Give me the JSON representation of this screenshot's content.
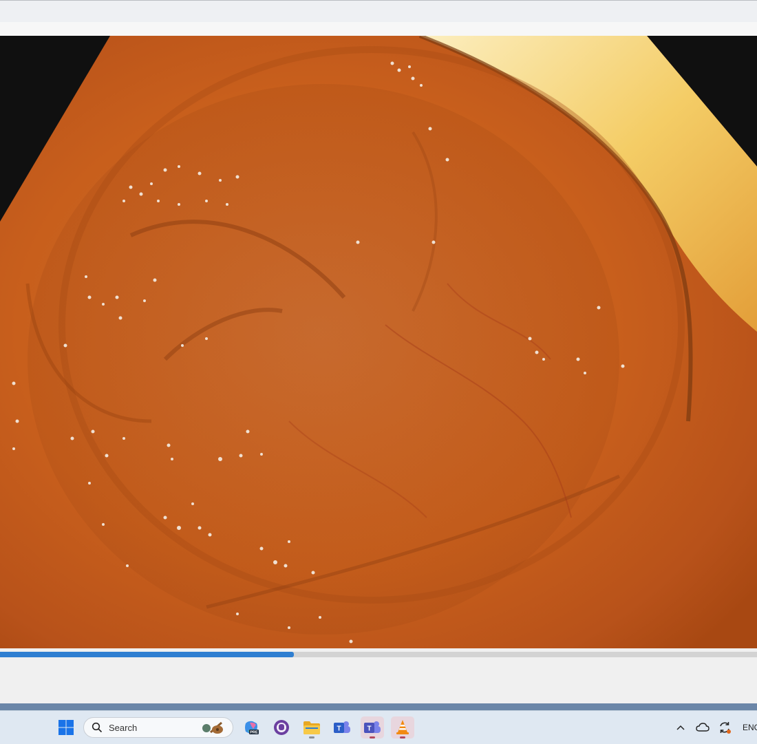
{
  "taskbar": {
    "search_placeholder": "Search",
    "language": "ENG",
    "pinned_apps": [
      {
        "name": "Windows Start",
        "icon": "windows-logo-icon"
      },
      {
        "name": "Copilot",
        "icon": "copilot-icon",
        "badge": "PRE"
      },
      {
        "name": "GitHub Desktop",
        "icon": "github-icon"
      },
      {
        "name": "File Explorer",
        "icon": "folder-icon"
      },
      {
        "name": "Microsoft Teams (work)",
        "icon": "teams-icon"
      },
      {
        "name": "Microsoft Teams",
        "icon": "teams-icon"
      },
      {
        "name": "VLC media player",
        "icon": "vlc-cone-icon"
      }
    ]
  },
  "player": {
    "playback_progress": 0.388,
    "accent_color": "#2f7fd1"
  },
  "colors": {
    "taskbar_bg": "#dfe8f2",
    "video_tissue": "#c9621f",
    "video_border": "#101010"
  }
}
